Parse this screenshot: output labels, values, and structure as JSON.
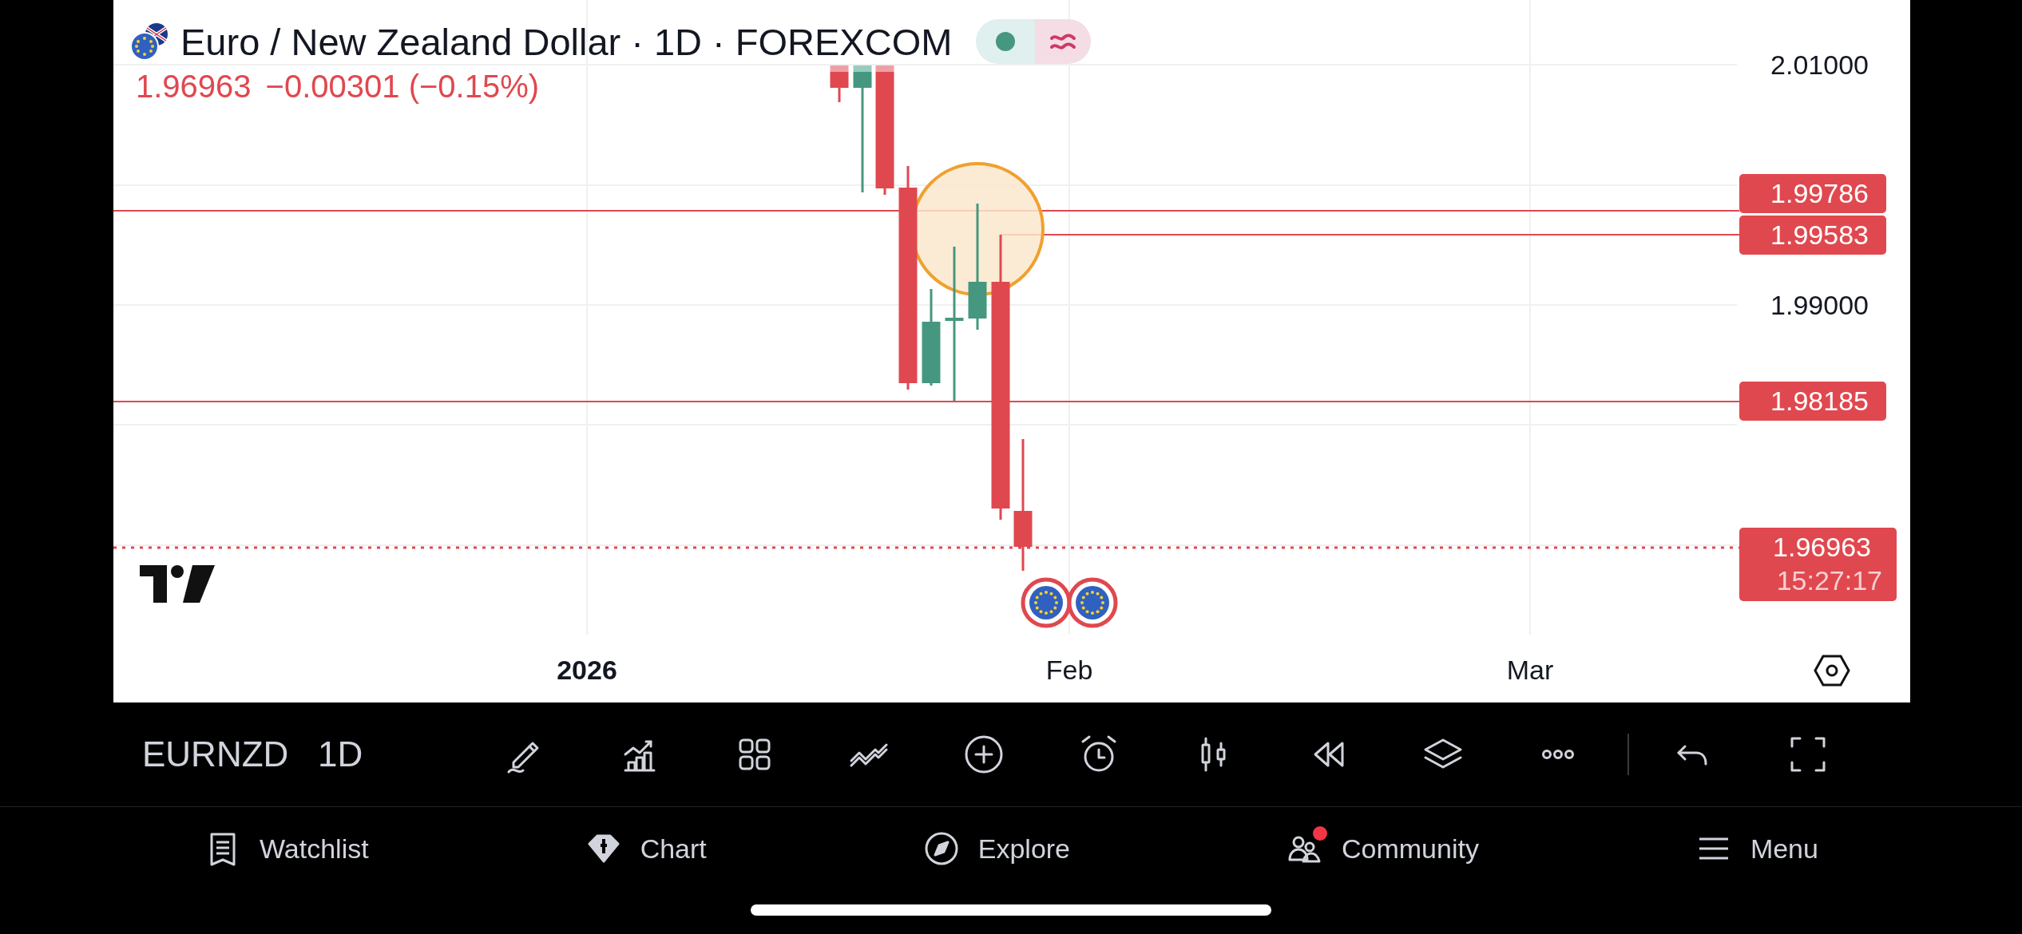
{
  "header": {
    "symbol_title": "Euro / New Zealand Dollar · 1D · FOREXCOM",
    "quote": "1.96963",
    "change": "−0.00301 (−0.15%)",
    "market_open": true
  },
  "price_axis": {
    "ticks": [
      "2.01000",
      "1.99000"
    ],
    "line_labels": [
      {
        "price": "1.99786"
      },
      {
        "price": "1.99583"
      },
      {
        "price": "1.98185"
      }
    ],
    "last_price": {
      "price": "1.96963",
      "countdown": "15:27:17"
    }
  },
  "time_axis": {
    "labels": [
      {
        "text": "2026",
        "bold": true
      },
      {
        "text": "Feb",
        "bold": false
      },
      {
        "text": "Mar",
        "bold": false
      }
    ]
  },
  "toolbar": {
    "symbol": "EURNZD",
    "interval": "1D"
  },
  "nav": [
    {
      "label": "Watchlist",
      "kind": "watchlist",
      "notification": false
    },
    {
      "label": "Chart",
      "kind": "chart",
      "notification": false
    },
    {
      "label": "Explore",
      "kind": "explore",
      "notification": false
    },
    {
      "label": "Community",
      "kind": "community",
      "notification": true
    },
    {
      "label": "Menu",
      "kind": "menu",
      "notification": false
    }
  ]
}
